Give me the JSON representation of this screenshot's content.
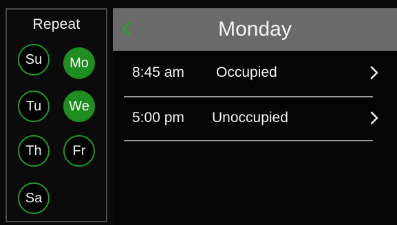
{
  "repeat": {
    "title": "Repeat",
    "days": [
      {
        "label": "Su",
        "selected": false
      },
      {
        "label": "Mo",
        "selected": true
      },
      {
        "label": "Tu",
        "selected": false
      },
      {
        "label": "We",
        "selected": true
      },
      {
        "label": "Th",
        "selected": false
      },
      {
        "label": "Fr",
        "selected": false
      },
      {
        "label": "Sa",
        "selected": false
      }
    ]
  },
  "header": {
    "title": "Monday",
    "back_icon": "chevron-left-icon"
  },
  "events": [
    {
      "time": "8:45 am",
      "state": "Occupied",
      "icon": "chevron-right-icon"
    },
    {
      "time": "5:00 pm",
      "state": "Unoccupied",
      "icon": "chevron-right-icon"
    }
  ],
  "colors": {
    "accent_green": "#1f8d1f",
    "header_gray": "#6a6a6a"
  }
}
